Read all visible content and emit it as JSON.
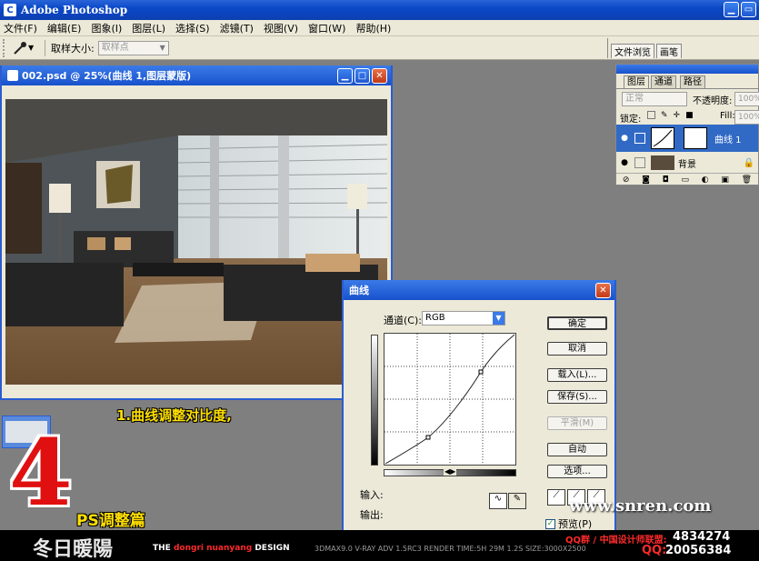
{
  "app": {
    "title": "Adobe Photoshop",
    "logo_letter": "C"
  },
  "menu": [
    "文件(F)",
    "编辑(E)",
    "图象(I)",
    "图层(L)",
    "选择(S)",
    "滤镜(T)",
    "视图(V)",
    "窗口(W)",
    "帮助(H)"
  ],
  "options": {
    "sample_size_label": "取样大小:",
    "sample_size_value": "取样点"
  },
  "well_tabs": [
    "文件浏览",
    "画笔"
  ],
  "document": {
    "title": "002.psd @ 25%(曲线 1,图层蒙版)"
  },
  "layers_palette": {
    "tabs": [
      "图层",
      "通道",
      "路径"
    ],
    "blend_mode": "正常",
    "opacity_label": "不透明度:",
    "opacity_value": "100%",
    "lock_label": "锁定:",
    "fill_label": "Fill:",
    "fill_value": "100%",
    "layers": [
      {
        "name": "曲线 1",
        "selected": true
      },
      {
        "name": "背景",
        "selected": false
      }
    ]
  },
  "curves_dialog": {
    "title": "曲线",
    "channel_label": "通道(C):",
    "channel_value": "RGB",
    "buttons": {
      "ok": "确定",
      "cancel": "取消",
      "load": "载入(L)...",
      "save": "保存(S)...",
      "smooth": "平滑(M)",
      "auto": "自动",
      "options": "选项..."
    },
    "input_label": "输入:",
    "output_label": "输出:",
    "preview_label": "预览(P)",
    "preview_checked": true
  },
  "overlay": {
    "caption": "1.曲线调整对比度,",
    "number": "4",
    "subtitle": "PS调整篇",
    "watermark": "www.snren.com"
  },
  "banner": {
    "brand": "冬日暖陽",
    "design_prefix": "THE",
    "design_name": "dongri nuanyang",
    "design_suffix": "DESIGN",
    "specs": "3DMAX9.0  V-RAY ADV 1.5RC3  RENDER TIME:5H 29M 1.2S  SIZE:3000X2500",
    "group_label": "QQ群 / 中国设计师联盟:",
    "group_number": "4834274",
    "qq_label": "QQ:",
    "qq_number": "20056384"
  },
  "colors": {
    "title_blue": "#0a48c8",
    "highlight_yellow": "#ffe000",
    "banner_red": "#ff2a2a"
  }
}
